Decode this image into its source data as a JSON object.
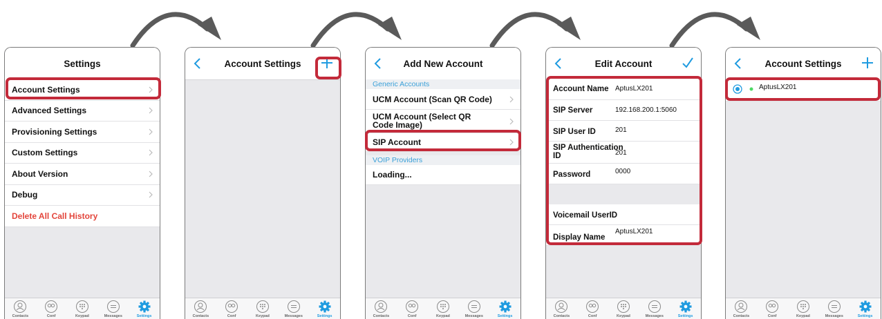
{
  "colors": {
    "accent": "#1f9be0",
    "highlight": "#c32a3a",
    "danger": "#e3453b",
    "arrow": "#5a5a5a"
  },
  "tabbar": [
    "Contacts",
    "Conf",
    "Keypad",
    "Messages",
    "Settings"
  ],
  "screen1": {
    "title": "Settings",
    "items": [
      "Account Settings",
      "Advanced Settings",
      "Provisioning Settings",
      "Custom Settings",
      "About Version",
      "Debug"
    ],
    "danger_item": "Delete All Call History"
  },
  "screen2": {
    "title": "Account Settings"
  },
  "screen3": {
    "title": "Add New Account",
    "section_generic": "Generic Accounts",
    "ucm_scan": "UCM Account (Scan QR Code)",
    "ucm_select_line1": "UCM Account (Select QR",
    "ucm_select_line2": "Code Image)",
    "sip_account": "SIP  Account",
    "section_voip": "VOIP Providers",
    "loading": "Loading..."
  },
  "screen4": {
    "title": "Edit Account",
    "account_name_label": "Account Name",
    "account_name_value": "AptusLX201",
    "sip_server_label": "SIP Server",
    "sip_server_value": "192.168.200.1:5060",
    "sip_user_id_label": "SIP User ID",
    "sip_user_id_value": "201",
    "sip_auth_label_line1": "SIP Authentication",
    "sip_auth_label_line2": "ID",
    "sip_auth_value": "201",
    "password_label": "Password",
    "password_value": "0000",
    "voicemail_label": "Voicemail UserID",
    "display_name_label": "Display Name",
    "display_name_value": "AptusLX201"
  },
  "screen5": {
    "title": "Account Settings",
    "account_label": "AptusLX201"
  }
}
